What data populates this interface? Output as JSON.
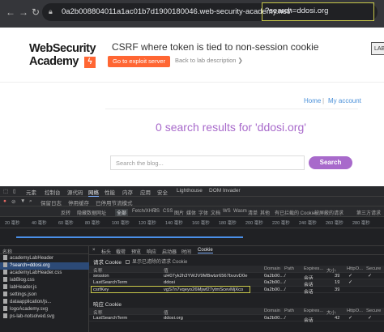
{
  "browser": {
    "url_main": "0a2b008804011a1ac01b7d1900180046.web-security-academy.net/",
    "url_query": "?search=ddosi.org",
    "back_icon": "arrow-left-icon",
    "forward_icon": "arrow-right-icon",
    "reload_icon": "reload-icon"
  },
  "lab": {
    "logo_line1": "WebSecurity",
    "logo_line2": "Academy",
    "title": "CSRF where token is tied to non-session cookie",
    "exploit_button": "Go to exploit server",
    "back_link": "Back to lab description ❯",
    "status": "LAB"
  },
  "nav": {
    "home": "Home",
    "sep": "|",
    "account": "My account"
  },
  "results_text": "0 search results for 'ddosi.org'",
  "search": {
    "placeholder": "Search the blog...",
    "button": "Search"
  },
  "devtools": {
    "tabs": [
      "元素",
      "控制台",
      "源代码",
      "网络",
      "性能",
      "内存",
      "应用",
      "安全",
      "Lighthouse",
      "DOM Invader"
    ],
    "active_tab": "网络",
    "toolbar": [
      "保留日志",
      "停用缓存",
      "已停用节流模式"
    ],
    "filter_items": [
      "反转",
      "隐藏数据网址",
      "全部",
      "Fetch/XHR",
      "JS",
      "CSS",
      "图片",
      "媒体",
      "字体",
      "文档",
      "WS",
      "Wasm",
      "清单",
      "其他",
      "有已拦截的 Cookie",
      "被屏蔽的请求",
      "第三方请求"
    ],
    "filter_active": "全部",
    "timeline_ticks": [
      "20 毫秒",
      "40 毫秒",
      "60 毫秒",
      "80 毫秒",
      "100 毫秒",
      "120 毫秒",
      "140 毫秒",
      "160 毫秒",
      "180 毫秒",
      "200 毫秒",
      "220 毫秒",
      "240 毫秒",
      "260 毫秒",
      "280 毫秒"
    ],
    "request_list_header": "名称",
    "requests": [
      "academyLabHeader",
      "?search=ddosi.org",
      "academyLabHeader.css",
      "labBlog.css",
      "labHeader.js",
      "settings.json",
      "dataapplication/js...",
      "logoAcademy.svg",
      "ps-lab-notsolved.svg"
    ],
    "selected_request": 1,
    "detail_tabs": [
      "×",
      "标头",
      "载荷",
      "预览",
      "响应",
      "启动器",
      "时间",
      "Cookie"
    ],
    "detail_active": "Cookie",
    "request_cookies_label": "请求 Cookie",
    "raw_toggle": "显示已滤除的请求 Cookie",
    "columns": [
      "名称",
      "值",
      "Domain",
      "Path",
      "Expires...",
      "大小",
      "HttpO...",
      "Secure"
    ],
    "request_cookies": [
      [
        "session",
        "uH07yk2h3YWJV9MBwtzr6567bvzvD0e",
        "0a2b00...",
        "/",
        "会话",
        "39",
        "✓",
        "✓"
      ],
      [
        "LastSearchTerm",
        "ddosi",
        "0a2b00...",
        "/",
        "会话",
        "19",
        "✓",
        ""
      ],
      [
        "csrfKey",
        "vgS7n7vqeyo26Mjwf27ytmScevMjXco",
        "0a2b00...",
        "/",
        "会话",
        "39",
        "",
        ""
      ]
    ],
    "response_cookies_label": "响应 Cookie",
    "response_cookies": [
      [
        "LastSearchTerm",
        "ddosi.org",
        "0a2b00...",
        "/",
        "会话",
        "42",
        "✓",
        "✓"
      ]
    ]
  }
}
